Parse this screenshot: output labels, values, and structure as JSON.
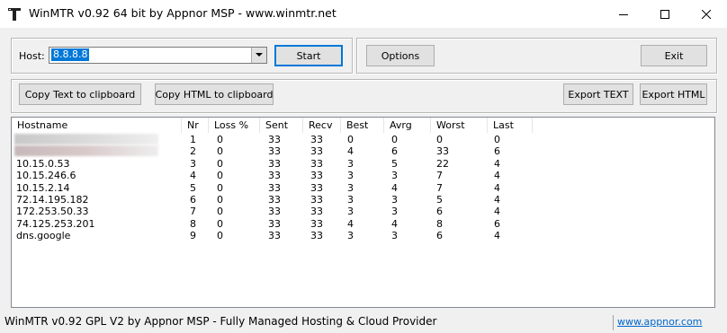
{
  "window": {
    "title": "WinMTR v0.92 64 bit by Appnor MSP - www.winmtr.net",
    "icon": "winmtr-app-icon",
    "controls": [
      "minimize-icon",
      "maximize-icon",
      "close-icon"
    ]
  },
  "host": {
    "label": "Host:",
    "value": "8.8.8.8"
  },
  "buttons": {
    "start": "Start",
    "options": "Options",
    "exit": "Exit",
    "copy_text": "Copy Text to clipboard",
    "copy_html": "Copy HTML to clipboard",
    "export_text": "Export TEXT",
    "export_html": "Export HTML"
  },
  "table": {
    "columns": [
      "Hostname",
      "Nr",
      "Loss %",
      "Sent",
      "Recv",
      "Best",
      "Avrg",
      "Worst",
      "Last"
    ],
    "rows": [
      {
        "hostname": "",
        "nr": "1",
        "loss": "0",
        "sent": "33",
        "recv": "33",
        "best": "0",
        "avrg": "0",
        "worst": "0",
        "last": "0"
      },
      {
        "hostname": "",
        "nr": "2",
        "loss": "0",
        "sent": "33",
        "recv": "33",
        "best": "4",
        "avrg": "6",
        "worst": "33",
        "last": "6"
      },
      {
        "hostname": "10.15.0.53",
        "nr": "3",
        "loss": "0",
        "sent": "33",
        "recv": "33",
        "best": "3",
        "avrg": "5",
        "worst": "22",
        "last": "4"
      },
      {
        "hostname": "10.15.246.6",
        "nr": "4",
        "loss": "0",
        "sent": "33",
        "recv": "33",
        "best": "3",
        "avrg": "3",
        "worst": "7",
        "last": "4"
      },
      {
        "hostname": "10.15.2.14",
        "nr": "5",
        "loss": "0",
        "sent": "33",
        "recv": "33",
        "best": "3",
        "avrg": "4",
        "worst": "7",
        "last": "4"
      },
      {
        "hostname": "72.14.195.182",
        "nr": "6",
        "loss": "0",
        "sent": "33",
        "recv": "33",
        "best": "3",
        "avrg": "3",
        "worst": "5",
        "last": "4"
      },
      {
        "hostname": "172.253.50.33",
        "nr": "7",
        "loss": "0",
        "sent": "33",
        "recv": "33",
        "best": "3",
        "avrg": "3",
        "worst": "6",
        "last": "4"
      },
      {
        "hostname": "74.125.253.201",
        "nr": "8",
        "loss": "0",
        "sent": "33",
        "recv": "33",
        "best": "4",
        "avrg": "4",
        "worst": "8",
        "last": "6"
      },
      {
        "hostname": "dns.google",
        "nr": "9",
        "loss": "0",
        "sent": "33",
        "recv": "33",
        "best": "3",
        "avrg": "3",
        "worst": "6",
        "last": "4"
      }
    ]
  },
  "status": {
    "text": "WinMTR v0.92 GPL V2 by Appnor MSP - Fully Managed Hosting & Cloud Provider",
    "link": "www.appnor.com"
  },
  "colors": {
    "selection": "#0078d7",
    "link": "#0066cc",
    "window_bg": "#f0f0f0"
  }
}
